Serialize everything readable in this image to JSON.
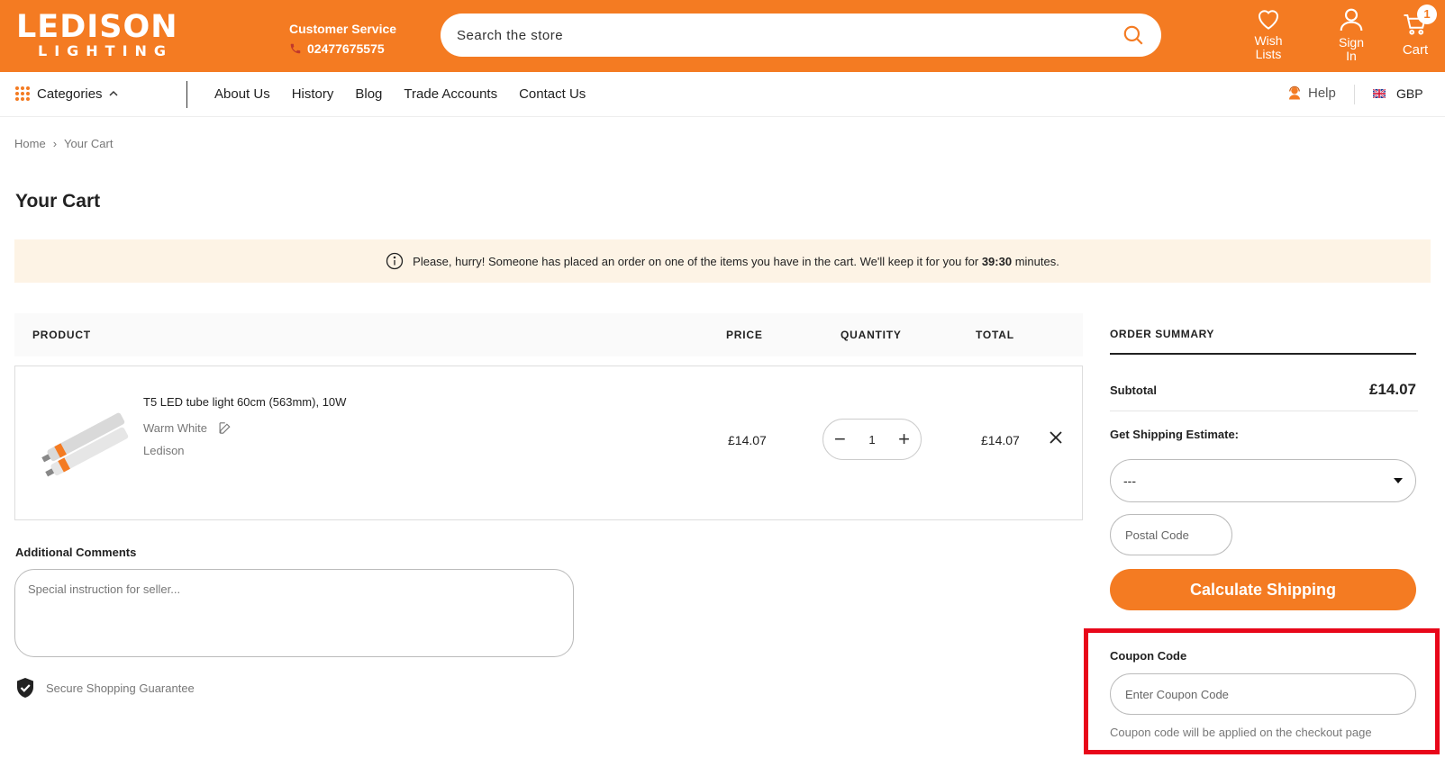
{
  "brand": {
    "line1": "LEDISON",
    "line2": "LIGHTING",
    "color": "#f47b22"
  },
  "header": {
    "customer_service_label": "Customer Service",
    "phone": "02477675575",
    "search_placeholder": "Search the store",
    "wishlist_label_1": "Wish",
    "wishlist_label_2": "Lists",
    "signin_label_1": "Sign",
    "signin_label_2": "In",
    "cart_label": "Cart",
    "cart_count": "1"
  },
  "nav": {
    "categories_label": "Categories",
    "links": [
      "About Us",
      "History",
      "Blog",
      "Trade Accounts",
      "Contact Us"
    ],
    "help_label": "Help",
    "currency": "GBP"
  },
  "breadcrumb": {
    "home": "Home",
    "current": "Your Cart"
  },
  "page_title": "Your Cart",
  "notice": {
    "text_before": "Please, hurry! Someone has placed an order on one of the items you have in the cart. We'll keep it for you for",
    "time": "39:30",
    "text_after": "minutes."
  },
  "table": {
    "headers": {
      "product": "PRODUCT",
      "price": "PRICE",
      "quantity": "QUANTITY",
      "total": "TOTAL"
    },
    "items": [
      {
        "name": "T5 LED tube light 60cm (563mm), 10W",
        "variant": "Warm White",
        "brand": "Ledison",
        "price": "£14.07",
        "quantity": "1",
        "total": "£14.07"
      }
    ]
  },
  "comments": {
    "label": "Additional Comments",
    "placeholder": "Special instruction for seller..."
  },
  "secure_text": "Secure Shopping Guarantee",
  "summary": {
    "title": "ORDER SUMMARY",
    "subtotal_label": "Subtotal",
    "subtotal_value": "£14.07",
    "shipping_label": "Get Shipping Estimate:",
    "shipping_selected": "---",
    "postal_placeholder": "Postal Code",
    "calc_button": "Calculate Shipping",
    "coupon_label": "Coupon Code",
    "coupon_placeholder": "Enter Coupon Code",
    "coupon_note": "Coupon code will be applied on the checkout page"
  }
}
